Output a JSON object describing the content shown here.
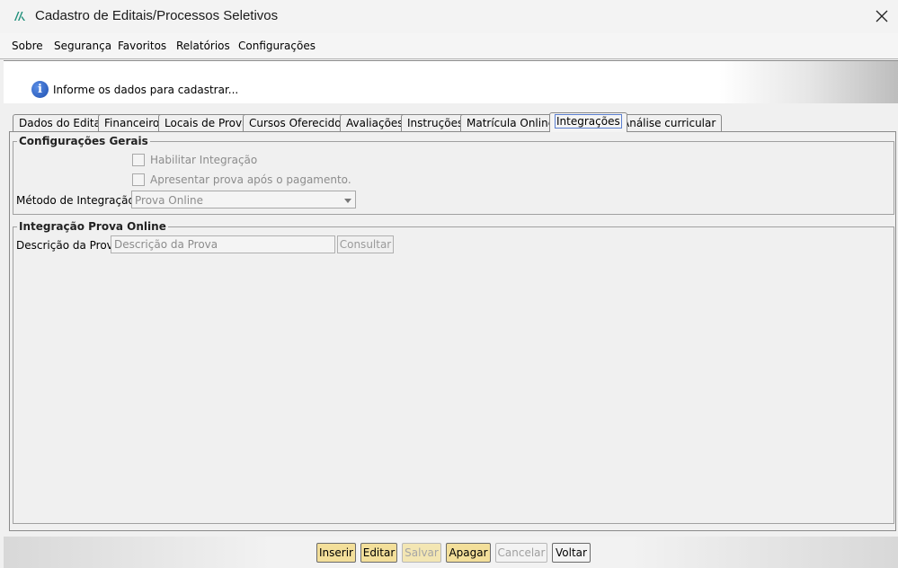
{
  "window": {
    "title": "Cadastro de Editais/Processos Seletivos"
  },
  "menu": [
    {
      "label": "Sobre"
    },
    {
      "label": "Segurança"
    },
    {
      "label": "Favoritos"
    },
    {
      "label": "Relatórios"
    },
    {
      "label": "Configurações"
    }
  ],
  "info": {
    "text": "Informe os dados para cadastrar..."
  },
  "tabs": [
    {
      "label": "Dados do Edital"
    },
    {
      "label": "Financeiro"
    },
    {
      "label": "Locais de Prova"
    },
    {
      "label": "Cursos Oferecidos"
    },
    {
      "label": "Avaliações"
    },
    {
      "label": "Instruções"
    },
    {
      "label": "Matrícula Online"
    },
    {
      "label": "Integrações"
    },
    {
      "label": "Análise curricular"
    }
  ],
  "active_tab": "Integrações",
  "config_gerais": {
    "legend": "Configurações Gerais",
    "habilitar_label": "Habilitar Integração",
    "apresentar_label": "Apresentar prova após o pagamento.",
    "metodo_label": "Método de Integração:",
    "metodo_value": "Prova Online"
  },
  "prova_online": {
    "legend": "Integração Prova Online",
    "descricao_label": "Descrição da Prova:",
    "descricao_placeholder": "Descrição da Prova",
    "consultar_label": "Consultar"
  },
  "actions": {
    "inserir": "Inserir",
    "editar": "Editar",
    "salvar": "Salvar",
    "apagar": "Apagar",
    "cancelar": "Cancelar",
    "voltar": "Voltar"
  }
}
